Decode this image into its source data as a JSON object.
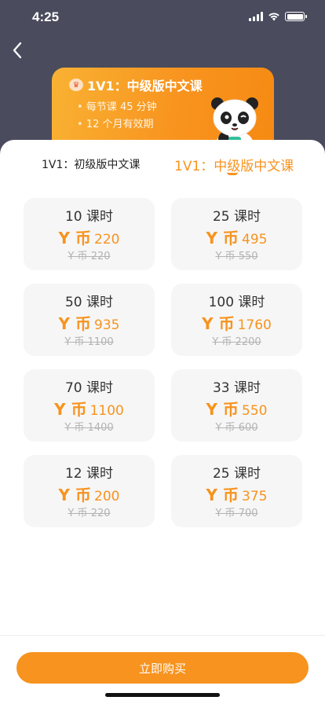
{
  "status_bar": {
    "time": "4:25"
  },
  "hero": {
    "title": "1V1：中级版中文课",
    "features": [
      "每节课 45 分钟",
      "12 个月有效期"
    ]
  },
  "tabs": [
    {
      "label": "1V1：初级版中文课",
      "active": false
    },
    {
      "label": "1V1：中级版中文课",
      "active": true
    }
  ],
  "packages": [
    {
      "hours": "10 课时",
      "currency": "Y 币",
      "price": "220",
      "original": "Y 币 220"
    },
    {
      "hours": "25 课时",
      "currency": "Y 币",
      "price": "495",
      "original": "Y 币 550"
    },
    {
      "hours": "50 课时",
      "currency": "Y 币",
      "price": "935",
      "original": "Y 币 1100"
    },
    {
      "hours": "100 课时",
      "currency": "Y 币",
      "price": "1760",
      "original": "Y 币 2200"
    },
    {
      "hours": "70 课时",
      "currency": "Y 币",
      "price": "1100",
      "original": "Y 币 1400"
    },
    {
      "hours": "33 课时",
      "currency": "Y 币",
      "price": "550",
      "original": "Y 币 600"
    },
    {
      "hours": "12 课时",
      "currency": "Y 币",
      "price": "200",
      "original": "Y 币 220"
    },
    {
      "hours": "25 课时",
      "currency": "Y 币",
      "price": "375",
      "original": "Y 币 700"
    }
  ],
  "buy_button": {
    "label": "立即购买"
  },
  "colors": {
    "accent": "#f7931e",
    "header_bg": "#4a4b5d",
    "card_bg": "#f6f6f6"
  },
  "icons": {
    "back": "chevron-left-icon",
    "crown": "crown-icon"
  }
}
